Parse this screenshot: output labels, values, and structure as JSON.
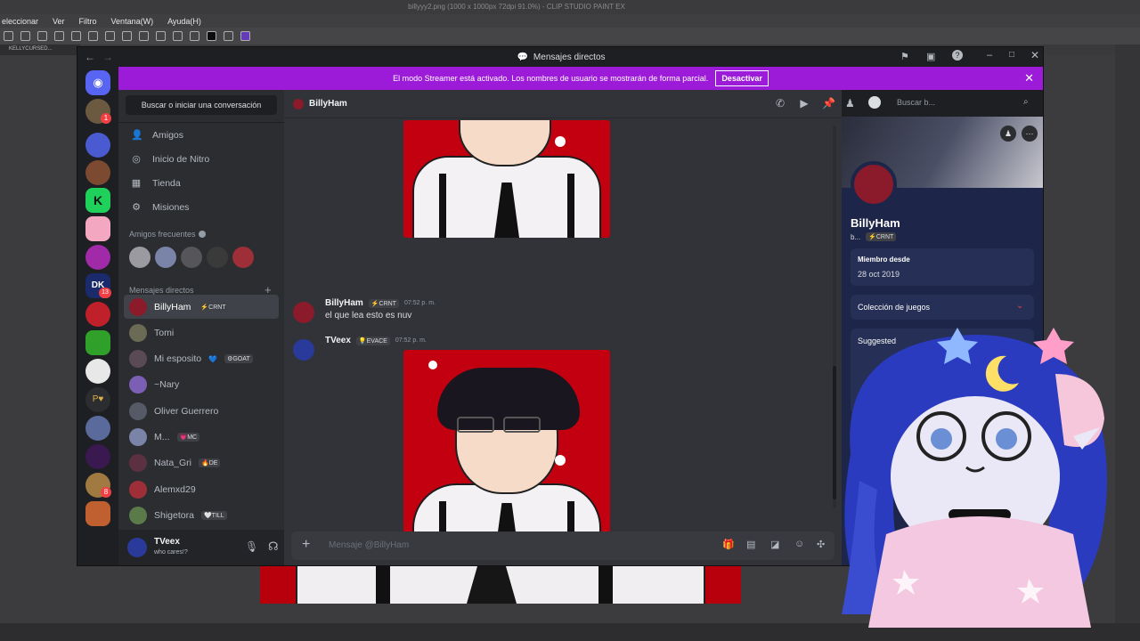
{
  "background_app": {
    "menu": [
      "eleccionar",
      "Ver",
      "Filtro",
      "Ventana(W)",
      "Ayuda(H)"
    ],
    "window_title": "billyyy2.png (1000 x 1000px 72dpi 91.0%) - CLIP STUDIO PAINT EX",
    "tab_label": "KELLYCURSED..."
  },
  "discord": {
    "window_title": "Mensajes directos",
    "banner": {
      "text": "El modo Streamer está activado. Los nombres de usuario se mostrarán de forma parcial.",
      "button": "Desactivar"
    },
    "guild_badges": [
      "1",
      "13",
      "8"
    ],
    "guild_label": "DK",
    "search_conversation": "Buscar o iniciar una conversación",
    "nav": [
      "Amigos",
      "Inicio de Nitro",
      "Tienda",
      "Misiones"
    ],
    "frequent_friends_label": "Amigos frecuentes",
    "dm_section_label": "Mensajes directos",
    "dms": [
      {
        "name": "BillyHam",
        "tag": "⚡CRNT",
        "color": "#8b1a2b",
        "active": true
      },
      {
        "name": "Tomi",
        "tag": "",
        "color": "#6b6a55"
      },
      {
        "name": "Mi esposito",
        "tag": "⚙GOAT",
        "color": "#5a4a55",
        "heart": "💙"
      },
      {
        "name": "~Nary",
        "tag": "",
        "color": "#7b5fb4"
      },
      {
        "name": "Oliver Guerrero",
        "tag": "",
        "color": "#555a66"
      },
      {
        "name": "M...",
        "tag": "💗MC",
        "color": "#7a83a8"
      },
      {
        "name": "Nata_Gri",
        "tag": "🔥DE",
        "color": "#5b3040"
      },
      {
        "name": "Alemxd29",
        "tag": "",
        "color": "#9e2f38"
      },
      {
        "name": "Shigetora",
        "tag": "🤍TILL",
        "color": "#5a7a4a"
      }
    ],
    "user": {
      "name": "TVeex",
      "status": "who cares!?"
    },
    "chat": {
      "header_name": "BillyHam",
      "search_placeholder": "Buscar b...",
      "messages": [
        {
          "author": "BillyHam",
          "tag": "⚡CRNT",
          "time": "07:52 p. m.",
          "text": "el que lea esto es nuv"
        },
        {
          "author": "TVeex",
          "tag": "💡EVACE",
          "time": "07:52 p. m.",
          "text": ""
        }
      ],
      "input_placeholder": "Mensaje @BillyHam"
    },
    "profile": {
      "name": "BillyHam",
      "sub": "b...",
      "tag": "⚡CRNT",
      "member_since_label": "Miembro desde",
      "member_since": "28 oct 2019",
      "games_label": "Colección de juegos",
      "suggested_label": "Suggested"
    }
  },
  "colors": {
    "accent": "#9b1bd8",
    "discord_bg": "#313338",
    "art_red": "#c20010"
  }
}
